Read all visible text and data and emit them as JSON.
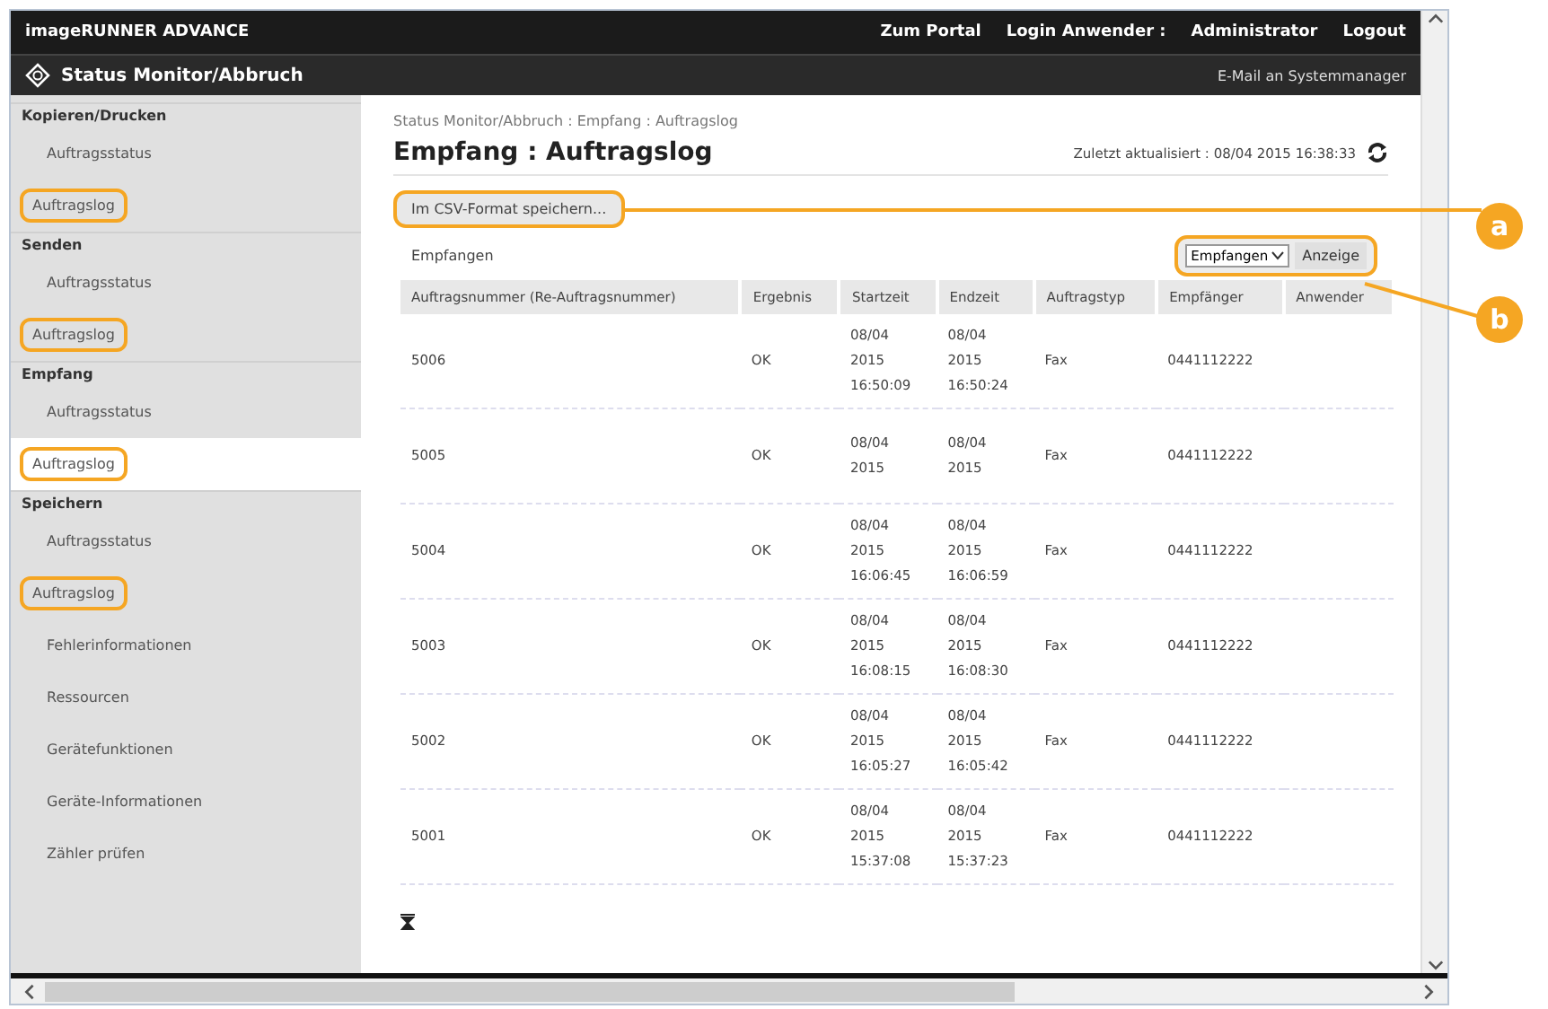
{
  "top_bar": {
    "product": "imageRUNNER ADVANCE",
    "links": [
      "Zum Portal",
      "Login Anwender :",
      "Administrator",
      "Logout"
    ]
  },
  "nav_bar": {
    "title": "Status Monitor/Abbruch",
    "link": "E-Mail an Systemmanager"
  },
  "sidebar": {
    "groups": [
      {
        "heading": "Kopieren/Drucken",
        "items": [
          {
            "label": "Auftragsstatus",
            "selected": false,
            "highlighted": false
          },
          {
            "label": "Auftragslog",
            "selected": false,
            "highlighted": true
          }
        ]
      },
      {
        "heading": "Senden",
        "items": [
          {
            "label": "Auftragsstatus",
            "selected": false,
            "highlighted": false
          },
          {
            "label": "Auftragslog",
            "selected": false,
            "highlighted": true
          }
        ]
      },
      {
        "heading": "Empfang",
        "items": [
          {
            "label": "Auftragsstatus",
            "selected": false,
            "highlighted": false
          },
          {
            "label": "Auftragslog",
            "selected": true,
            "highlighted": true
          }
        ]
      },
      {
        "heading": "Speichern",
        "items": [
          {
            "label": "Auftragsstatus",
            "selected": false,
            "highlighted": false
          },
          {
            "label": "Auftragslog",
            "selected": false,
            "highlighted": true
          }
        ]
      },
      {
        "items": [
          {
            "label": "Fehlerinformationen",
            "selected": false,
            "highlighted": false
          },
          {
            "label": "Ressourcen",
            "selected": false,
            "highlighted": false
          },
          {
            "label": "Gerätefunktionen",
            "selected": false,
            "highlighted": false
          },
          {
            "label": "Geräte-Informationen",
            "selected": false,
            "highlighted": false
          },
          {
            "label": "Zähler prüfen",
            "selected": false,
            "highlighted": false
          }
        ]
      }
    ]
  },
  "content": {
    "breadcrumb": "Status Monitor/Abbruch : Empfang : Auftragslog",
    "title": "Empfang : Auftragslog",
    "updated": "Zuletzt aktualisiert : 08/04 2015 16:38:33",
    "csv_button": {
      "label": "Im CSV-Format speichern...",
      "highlighted": true
    },
    "list_label": "Empfangen",
    "filter": {
      "value": "Empfangen",
      "button": "Anzeige",
      "highlighted": true
    },
    "table": {
      "columns": [
        "Auftragsnummer (Re-Auftragsnummer)",
        "Ergebnis",
        "Startzeit",
        "Endzeit",
        "Auftragstyp",
        "Empfänger",
        "Anwender"
      ],
      "rows": [
        [
          "5006",
          "OK",
          [
            "08/04",
            "2015",
            "16:50:09"
          ],
          [
            "08/04",
            "2015",
            "16:50:24"
          ],
          "Fax",
          "0441112222"
        ],
        [
          "5005",
          "OK",
          [
            "08/04",
            "2015"
          ],
          [
            "08/04",
            "2015"
          ],
          "Fax",
          "0441112222"
        ],
        [
          "5004",
          "OK",
          [
            "08/04",
            "2015",
            "16:06:45"
          ],
          [
            "08/04",
            "2015",
            "16:06:59"
          ],
          "Fax",
          "0441112222"
        ],
        [
          "5003",
          "OK",
          [
            "08/04",
            "2015",
            "16:08:15"
          ],
          [
            "08/04",
            "2015",
            "16:08:30"
          ],
          "Fax",
          "0441112222"
        ],
        [
          "5002",
          "OK",
          [
            "08/04",
            "2015",
            "16:05:27"
          ],
          [
            "08/04",
            "2015",
            "16:05:42"
          ],
          "Fax",
          "0441112222"
        ],
        [
          "5001",
          "OK",
          [
            "08/04",
            "2015",
            "15:37:08"
          ],
          [
            "08/04",
            "2015",
            "15:37:23"
          ],
          "Fax",
          "0441112222"
        ]
      ]
    }
  },
  "callouts": [
    {
      "label": "a"
    },
    {
      "label": "b"
    }
  ]
}
